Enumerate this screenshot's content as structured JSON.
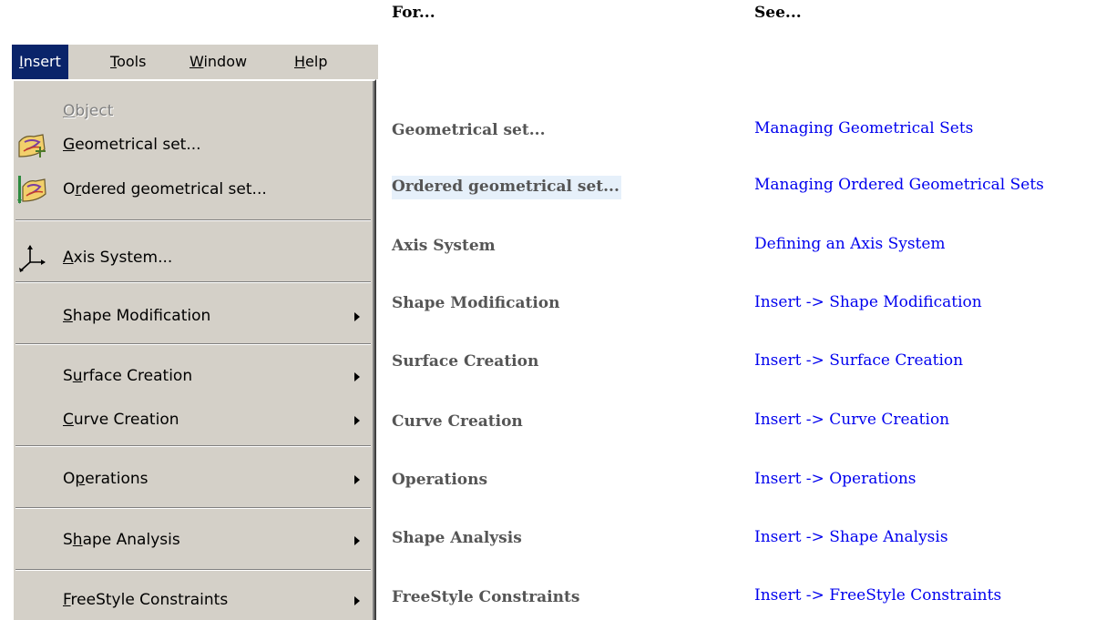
{
  "menubar": {
    "items": [
      {
        "label": "Insert",
        "mnemonic": "I",
        "rest": "nsert",
        "active": true
      },
      {
        "label": "Tools",
        "mnemonic": "T",
        "rest": "ools"
      },
      {
        "label": "Window",
        "mnemonic": "W",
        "rest": "indow"
      },
      {
        "label": "Help",
        "mnemonic": "H",
        "rest": "elp"
      }
    ]
  },
  "menu": {
    "items": [
      {
        "pre": "",
        "mn": "O",
        "post": "bject",
        "label": "Object",
        "disabled": true,
        "icon": null
      },
      {
        "pre": "",
        "mn": "G",
        "post": "eometrical set...",
        "label": "Geometrical set...",
        "icon": "geometrical-set-icon"
      },
      {
        "pre": "O",
        "mn": "r",
        "post": "dered geometrical set...",
        "label": "Ordered geometrical set...",
        "icon": "ordered-geometrical-set-icon"
      },
      {
        "pre": "",
        "mn": "A",
        "post": "xis System...",
        "label": "Axis System...",
        "icon": "axis-system-icon"
      },
      {
        "pre": "",
        "mn": "S",
        "post": "hape Modification",
        "label": "Shape Modification",
        "submenu": true
      },
      {
        "pre": "S",
        "mn": "u",
        "post": "rface Creation",
        "label": "Surface Creation",
        "submenu": true
      },
      {
        "pre": "",
        "mn": "C",
        "post": "urve Creation",
        "label": "Curve Creation",
        "submenu": true
      },
      {
        "pre": "O",
        "mn": "p",
        "post": "erations",
        "label": "Operations",
        "submenu": true
      },
      {
        "pre": "S",
        "mn": "h",
        "post": "ape Analysis",
        "label": "Shape Analysis",
        "submenu": true
      },
      {
        "pre": "",
        "mn": "F",
        "post": "reeStyle Constraints",
        "label": "FreeStyle Constraints",
        "submenu": true
      }
    ]
  },
  "table": {
    "header_for": "For...",
    "header_see": "See...",
    "rows": [
      {
        "for": "Geometrical set...",
        "see": "Managing Geometrical Sets"
      },
      {
        "for": "Ordered geometrical set...",
        "see": "Managing Ordered Geometrical Sets",
        "highlight": true
      },
      {
        "for": "Axis System",
        "see": "Defining an Axis System"
      },
      {
        "for": "Shape Modification",
        "see": "Insert -> Shape Modification"
      },
      {
        "for": "Surface Creation",
        "see": "Insert -> Surface Creation"
      },
      {
        "for": "Curve Creation",
        "see": "Insert -> Curve Creation"
      },
      {
        "for": "Operations",
        "see": "Insert -> Operations"
      },
      {
        "for": "Shape Analysis",
        "see": "Insert -> Shape Analysis"
      },
      {
        "for": "FreeStyle Constraints",
        "see": "Insert -> FreeStyle Constraints"
      }
    ]
  },
  "colors": {
    "menu_bg": "#d4d0c8",
    "menu_active": "#0a246a",
    "link": "#0000ee",
    "for_text": "#555555"
  }
}
